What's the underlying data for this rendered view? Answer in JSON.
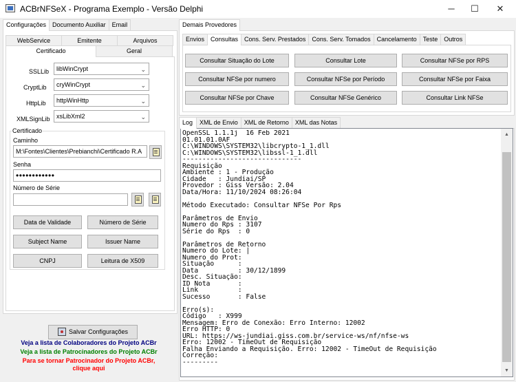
{
  "window": {
    "title": "ACBrNFSeX - Programa Exemplo - Versão Delphi",
    "minimize_glyph": "─",
    "maximize_glyph": "☐",
    "close_glyph": "✕"
  },
  "left": {
    "top_tabs": [
      "Configurações",
      "Documento Auxiliar",
      "Email"
    ],
    "sub_tabs_row1": [
      "WebService",
      "Emitente",
      "Arquivos"
    ],
    "sub_tabs_row2": [
      "Certificado",
      "Geral"
    ],
    "ssllib": {
      "label": "SSLLib",
      "value": "libWinCrypt"
    },
    "cryptlib": {
      "label": "CryptLib",
      "value": "cryWinCrypt"
    },
    "httplib": {
      "label": "HttpLib",
      "value": "httpWinHttp"
    },
    "xmlsignlib": {
      "label": "XMLSignLib",
      "value": "xsLibXml2"
    },
    "certificado": {
      "group_title": "Certificado",
      "caminho_label": "Caminho",
      "caminho_value": "M:\\Fontes\\Clientes\\Prebianchi\\Certificado R.A",
      "senha_label": "Senha",
      "senha_value": "••••••••••••",
      "numero_serie_label": "Número de Série",
      "numero_serie_value": ""
    },
    "buttons": {
      "data_validade": "Data de Validade",
      "numero_serie": "Número de Série",
      "subject_name": "Subject Name",
      "issuer_name": "Issuer Name",
      "cnpj": "CNPJ",
      "leitura_x509": "Leitura de X509"
    },
    "salvar": "Salvar Configurações",
    "links": {
      "colaboradores": "Veja a lista de Colaboradores do Projeto ACBr",
      "patrocinadores": "Veja a lista de Patrocinadores do Projeto ACBr",
      "tornar1": "Para se tornar Patrocinador do Projeto ACBr,",
      "tornar2": "clique aqui"
    },
    "link_colors": {
      "colaboradores": "#000080",
      "patrocinadores": "#008000",
      "tornar": "#ff0000"
    }
  },
  "right": {
    "top_tab": "Demais Provedores",
    "op_tabs": [
      "Envios",
      "Consultas",
      "Cons. Serv. Prestados",
      "Cons. Serv. Tomados",
      "Cancelamento",
      "Teste",
      "Outros"
    ],
    "consultas_buttons": [
      "Consultar Situação do Lote",
      "Consultar Lote",
      "Consultar NFSe por RPS",
      "Consultar NFSe por numero",
      "Consultar NFSe por Período",
      "Consultar NFSe por Faixa",
      "Consultar NFSe por Chave",
      "Consultar NFSe Genérico",
      "Consultar Link NFSe"
    ],
    "log_tabs": [
      "Log",
      "XML de Envio",
      "XML de Retorno",
      "XML das Notas"
    ],
    "log_lines": [
      "OpenSSL 1.1.1j  16 Feb 2021",
      "01.01.01.0AF",
      "C:\\WINDOWS\\SYSTEM32\\libcrypto-1_1.dll",
      "C:\\WINDOWS\\SYSTEM32\\libssl-1_1.dll",
      "------------------------------",
      "Requisição",
      "Ambiente : 1 - Produção",
      "Cidade   : Jundiai/SP",
      "Provedor : Giss Versão: 2.04",
      "Data/Hora: 11/10/2024 08:26:04",
      "",
      "Método Executado: Consultar NFSe Por Rps",
      "",
      "Parâmetros de Envio",
      "Numero do Rps : 3107",
      "Série do Rps  : 0",
      "",
      "Parâmetros de Retorno",
      "Numero do Lote: |",
      "Numero do Prot:",
      "Situação      :",
      "Data          : 30/12/1899",
      "Desc. Situação:",
      "ID Nota       :",
      "Link          :",
      "Sucesso       : False",
      "",
      "Erro(s):",
      "Código   : X999",
      "Mensagem: Erro de Conexão: Erro Interno: 12002",
      "Erro HTTP: 0",
      "URL: https://ws-jundiai.giss.com.br/service-ws/nf/nfse-ws",
      "Erro: 12002 - TimeOut de Requisição",
      "Falha Enviando a Requisição. Erro: 12002 - TimeOut de Requisição",
      "Correção:",
      "---------"
    ]
  }
}
